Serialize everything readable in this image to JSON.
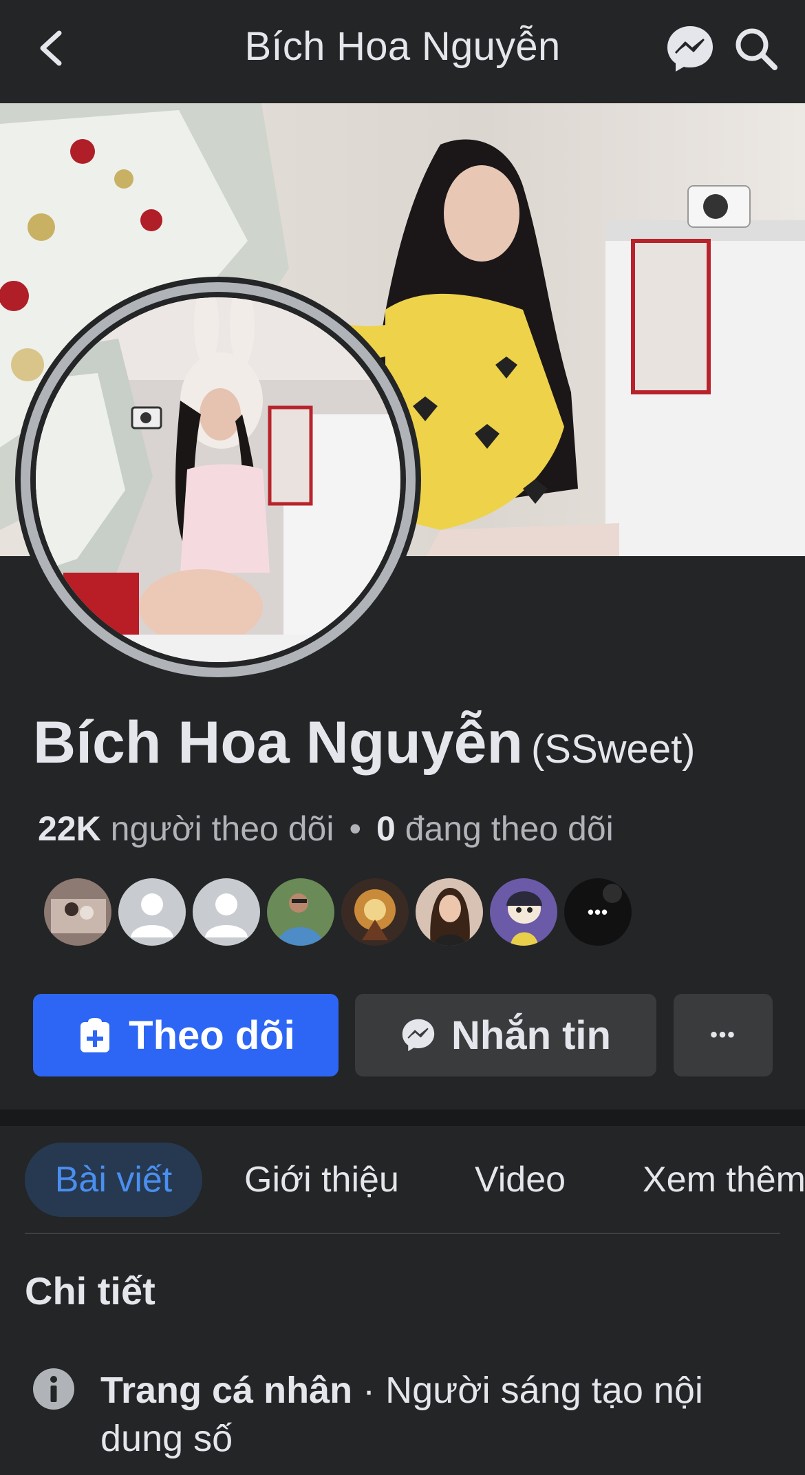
{
  "header": {
    "title": "Bích Hoa Nguyễn",
    "back_icon": "chevron-left-icon",
    "messenger_icon": "messenger-icon",
    "search_icon": "search-icon"
  },
  "profile": {
    "name": "Bích Hoa Nguyễn",
    "nickname": "(SSweet)",
    "followers_count": "22K",
    "followers_label": "người theo dõi",
    "separator": "•",
    "following_count": "0",
    "following_label": "đang theo dõi"
  },
  "follower_avatars_more": "•••",
  "actions": {
    "follow_label": "Theo dõi",
    "message_label": "Nhắn tin",
    "more_label": "•••"
  },
  "tabs": [
    {
      "label": "Bài viết",
      "active": true
    },
    {
      "label": "Giới thiệu",
      "active": false
    },
    {
      "label": "Video",
      "active": false
    },
    {
      "label": "Xem thêm",
      "active": false
    }
  ],
  "details": {
    "title": "Chi tiết",
    "item_strong": "Trang cá nhân",
    "item_sep": " · ",
    "item_text": "Người sáng tạo nội dung số"
  },
  "colors": {
    "background": "#242526",
    "accent": "#2d66f4",
    "tab_active_bg": "#263951",
    "tab_active_text": "#4a8ff0"
  }
}
